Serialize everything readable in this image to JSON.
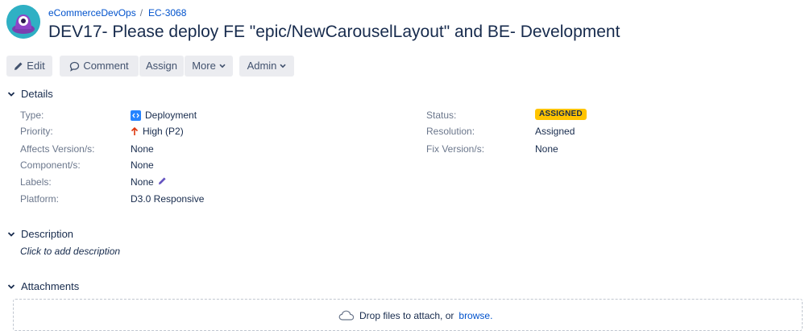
{
  "colors": {
    "accent": "#0052cc",
    "avatar_bg": "#2fb0c4",
    "avatar_body": "#8e44c7",
    "status_badge": "#ffc400",
    "priority_high": "#de350b",
    "type_icon": "#2684ff"
  },
  "header": {
    "avatar_icon": "project-avatar-icon",
    "breadcrumb": {
      "project": "eCommerceDevOps",
      "separator": "/",
      "issue_key": "EC-3068"
    },
    "title": "DEV17- Please deploy FE \"epic/NewCarouselLayout\" and BE- Development"
  },
  "toolbar": {
    "edit_label": "Edit",
    "comment_label": "Comment",
    "assign_label": "Assign",
    "more_label": "More",
    "admin_label": "Admin"
  },
  "details": {
    "heading": "Details",
    "left": [
      {
        "label": "Type:",
        "value": "Deployment",
        "icon": "deployment-icon"
      },
      {
        "label": "Priority:",
        "value": "High (P2)",
        "icon": "arrow-up-icon"
      },
      {
        "label": "Affects Version/s:",
        "value": "None"
      },
      {
        "label": "Component/s:",
        "value": "None"
      },
      {
        "label": "Labels:",
        "value": "None",
        "icon": "pencil-icon"
      },
      {
        "label": "Platform:",
        "value": "D3.0 Responsive"
      }
    ],
    "right": [
      {
        "label": "Status:",
        "value": "ASSIGNED"
      },
      {
        "label": "Resolution:",
        "value": "Assigned"
      },
      {
        "label": "Fix Version/s:",
        "value": "None"
      }
    ]
  },
  "description": {
    "heading": "Description",
    "placeholder": "Click to add description"
  },
  "attachments": {
    "heading": "Attachments",
    "drop_text": "Drop files to attach, or",
    "browse_link": "browse."
  }
}
